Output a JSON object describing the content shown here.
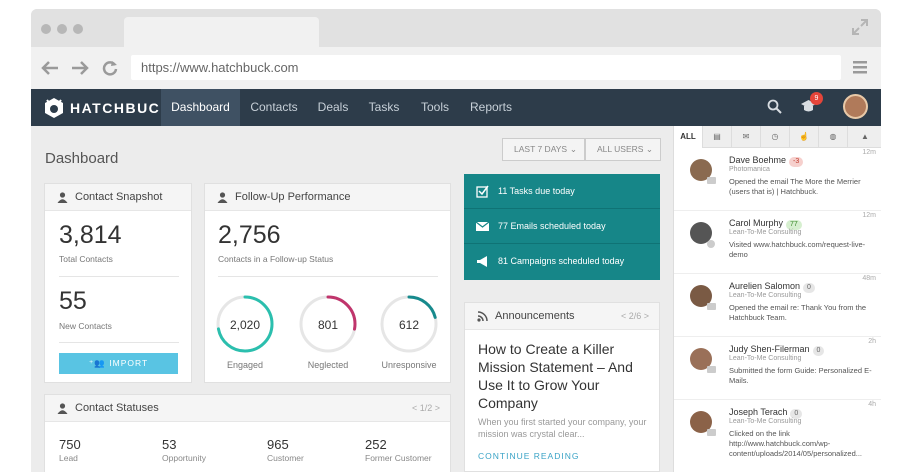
{
  "browser": {
    "url": "https://www.hatchbuck.com"
  },
  "app": {
    "logo_text": "HATCHBUCK"
  },
  "nav": {
    "items": [
      "Dashboard",
      "Contacts",
      "Deals",
      "Tasks",
      "Tools",
      "Reports"
    ],
    "notification_count": "9"
  },
  "page": {
    "title": "Dashboard",
    "filter_days": "LAST 7 DAYS",
    "filter_users": "ALL USERS"
  },
  "snapshot": {
    "title": "Contact Snapshot",
    "total_value": "3,814",
    "total_label": "Total Contacts",
    "new_value": "55",
    "new_label": "New Contacts",
    "import_label": "IMPORT"
  },
  "followup": {
    "title": "Follow-Up Performance",
    "value": "2,756",
    "label": "Contacts in a Follow-up Status",
    "rings": [
      {
        "value": "2,020",
        "label": "Engaged",
        "color": "#2bbfae",
        "fraction": 0.72
      },
      {
        "value": "801",
        "label": "Neglected",
        "color": "#c0356c",
        "fraction": 0.28
      },
      {
        "value": "612",
        "label": "Unresponsive",
        "color": "#178a8d",
        "fraction": 0.21
      }
    ]
  },
  "summary": {
    "tasks": "11 Tasks due today",
    "emails": "77 Emails scheduled today",
    "campaigns": "81 Campaigns scheduled today"
  },
  "announcements": {
    "title": "Announcements",
    "pager": "< 2/6 >",
    "headline": "How to Create a Killer Mission Statement – And Use It to Grow Your Company",
    "body": "When you first started your company, your mission was crystal clear...",
    "link": "CONTINUE READING"
  },
  "statuses": {
    "title": "Contact Statuses",
    "pager": "< 1/2 >",
    "items": [
      {
        "value": "750",
        "label": "Lead"
      },
      {
        "value": "53",
        "label": "Opportunity"
      },
      {
        "value": "965",
        "label": "Customer"
      },
      {
        "value": "252",
        "label": "Former Customer"
      }
    ]
  },
  "activity": {
    "tab_all": "ALL",
    "items": [
      {
        "name": "Dave Boehme",
        "score": "-3",
        "company": "Photomanica",
        "text": "Opened the email The More the Merrier (users that is) | Hatchbuck.",
        "time": "12m"
      },
      {
        "name": "Carol Murphy",
        "score": "77",
        "company": "Lean-To-Me Consulting",
        "text": "Visited www.hatchbuck.com/request-live-demo",
        "time": "12m"
      },
      {
        "name": "Aurelien Salomon",
        "score": "0",
        "company": "Lean-To-Me Consulting",
        "text": "Opened the email re: Thank You from the Hatchbuck Team.",
        "time": "48m"
      },
      {
        "name": "Judy Shen-Filerman",
        "score": "0",
        "company": "Lean-To-Me Consulting",
        "text": "Submitted the form Guide: Personalized E-Mails.",
        "time": "2h"
      },
      {
        "name": "Joseph Terach",
        "score": "0",
        "company": "Lean-To-Me Consulting",
        "text": "Clicked on the link http://www.hatchbuck.com/wp-content/uploads/2014/05/personalized...",
        "time": "4h"
      }
    ]
  }
}
